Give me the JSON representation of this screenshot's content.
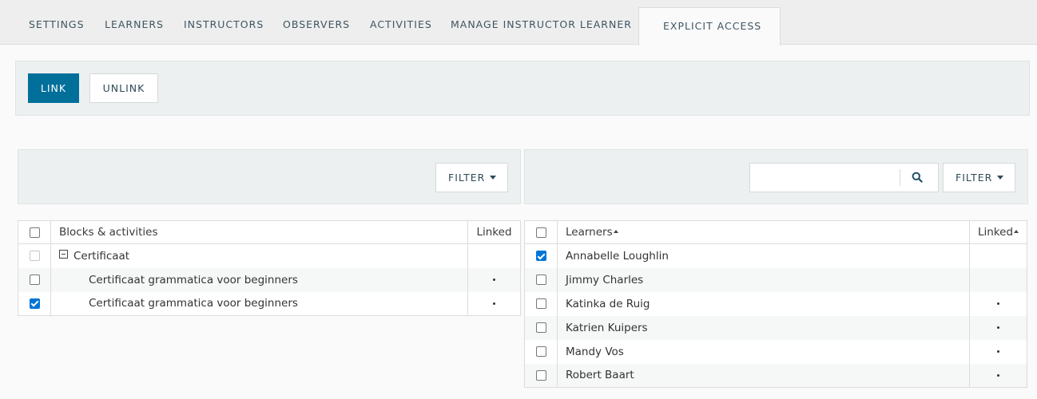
{
  "tabs": [
    {
      "label": "SETTINGS"
    },
    {
      "label": "LEARNERS"
    },
    {
      "label": "INSTRUCTORS"
    },
    {
      "label": "OBSERVERS"
    },
    {
      "label": "ACTIVITIES"
    },
    {
      "label": "MANAGE INSTRUCTOR LEARNER"
    },
    {
      "label": "EXPLICIT ACCESS",
      "active": true
    }
  ],
  "toolbar": {
    "link_label": "LINK",
    "unlink_label": "UNLINK"
  },
  "left_panel": {
    "filter_label": "FILTER"
  },
  "right_panel": {
    "filter_label": "FILTER",
    "search_value": "",
    "search_icon": "search-icon"
  },
  "activities_table": {
    "headers": {
      "name": "Blocks & activities",
      "linked": "Linked"
    },
    "rows": [
      {
        "name": "Certificaat",
        "type": "group",
        "checked": false,
        "disabled": true,
        "linked": false
      },
      {
        "name": "Certificaat grammatica voor beginners",
        "checked": false,
        "linked": true
      },
      {
        "name": "Certificaat grammatica voor beginners",
        "checked": true,
        "linked": true
      }
    ]
  },
  "learners_table": {
    "headers": {
      "name": "Learners",
      "linked": "Linked",
      "sort": "ascending"
    },
    "rows": [
      {
        "name": "Annabelle Loughlin",
        "checked": true,
        "linked": false
      },
      {
        "name": "Jimmy Charles",
        "checked": false,
        "linked": false
      },
      {
        "name": "Katinka de Ruig",
        "checked": false,
        "linked": true
      },
      {
        "name": "Katrien Kuipers",
        "checked": false,
        "linked": true
      },
      {
        "name": "Mandy Vos",
        "checked": false,
        "linked": true
      },
      {
        "name": "Robert Baart",
        "checked": false,
        "linked": true
      }
    ]
  },
  "colors": {
    "primary": "#006f9a",
    "checkbox_checked": "#0075d6",
    "panel_bg": "#edf0f0"
  }
}
